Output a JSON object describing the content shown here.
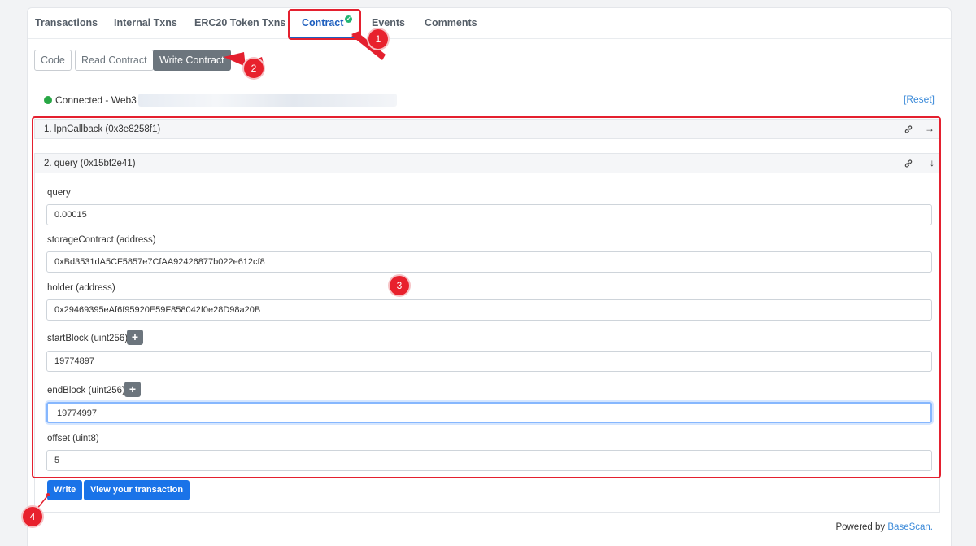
{
  "tabs": [
    {
      "label": "Transactions"
    },
    {
      "label": "Internal Txns"
    },
    {
      "label": "ERC20 Token Txns"
    },
    {
      "label": "Contract"
    },
    {
      "label": "Events"
    },
    {
      "label": "Comments"
    }
  ],
  "subtabs": {
    "code": "Code",
    "read": "Read Contract",
    "write": "Write Contract"
  },
  "connection": {
    "status": "Connected - Web3",
    "reset": "[Reset]"
  },
  "functions": [
    {
      "title": "1. lpnCallback (0x3e8258f1)",
      "arrow": "→"
    },
    {
      "title": "2. query (0x15bf2e41)",
      "arrow": "↓"
    }
  ],
  "fields": {
    "query": {
      "label": "query",
      "value": "0.00015"
    },
    "storage": {
      "label": "storageContract (address)",
      "value": "0xBd3531dA5CF5857e7CfAA92426877b022e612cf8"
    },
    "holder": {
      "label": "holder (address)",
      "value": "0x29469395eAf6f95920E59F858042f0e28D98a20B"
    },
    "start": {
      "label": "startBlock (uint256)",
      "value": "19774897"
    },
    "end": {
      "label": "endBlock (uint256)",
      "value": "19774997"
    },
    "offset": {
      "label": "offset (uint8)",
      "value": "5"
    }
  },
  "plus_symbol": "+",
  "actions": {
    "write": "Write",
    "view_tx": "View your transaction"
  },
  "footer": {
    "prefix": "Powered by ",
    "brand": "BaseScan."
  },
  "annotations": [
    "1",
    "2",
    "3",
    "4"
  ],
  "colors": {
    "annotation_red": "#e4202f",
    "primary": "#1a73e8",
    "active_tab": "#1e5fbf"
  }
}
